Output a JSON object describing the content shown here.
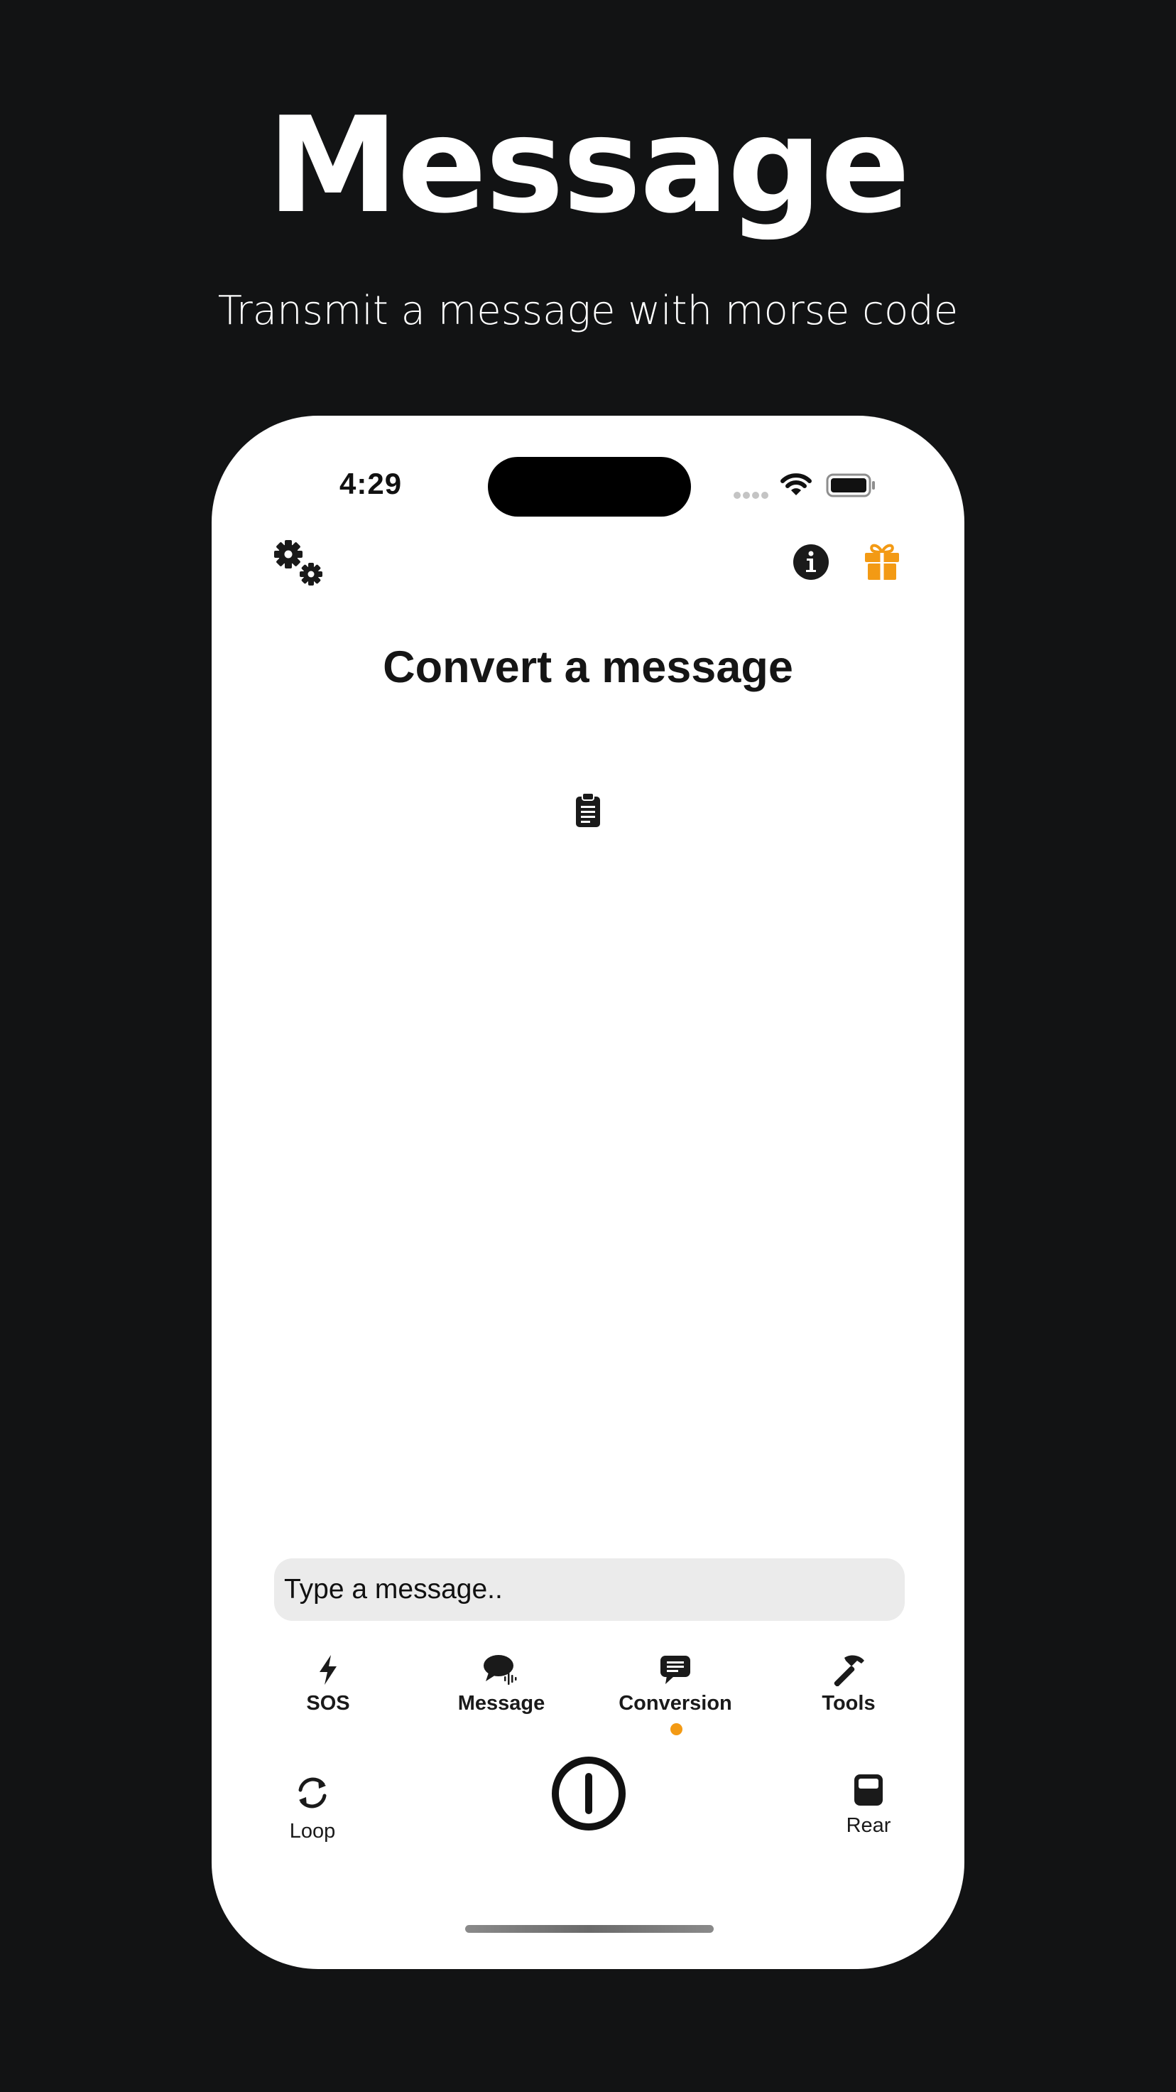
{
  "marketing": {
    "title": "Message",
    "subtitle": "Transmit a message with morse code"
  },
  "status_bar": {
    "time": "4:29",
    "icons": [
      "cellular-signal-icon",
      "wifi-icon",
      "battery-icon"
    ]
  },
  "header": {
    "left_icon": "gears-icon",
    "right_icons": [
      "info-icon",
      "gift-icon"
    ]
  },
  "main": {
    "title": "Convert a message",
    "paste_icon": "clipboard-icon"
  },
  "input": {
    "placeholder": "Type a message..",
    "value": ""
  },
  "tabs": [
    {
      "label": "SOS",
      "icon": "bolt-icon",
      "active": false
    },
    {
      "label": "Message",
      "icon": "speech-bubble-waveform-icon",
      "active": false
    },
    {
      "label": "Conversion",
      "icon": "text-bubble-icon",
      "active": true
    },
    {
      "label": "Tools",
      "icon": "hammer-icon",
      "active": false
    }
  ],
  "controls": {
    "loop_label": "Loop",
    "rear_label": "Rear",
    "power_icon": "power-icon"
  },
  "colors": {
    "background": "#121314",
    "accent": "#F39A14",
    "screen": "#FFFFFF",
    "input_background": "#EBEBEB",
    "text_dark": "#151515"
  }
}
